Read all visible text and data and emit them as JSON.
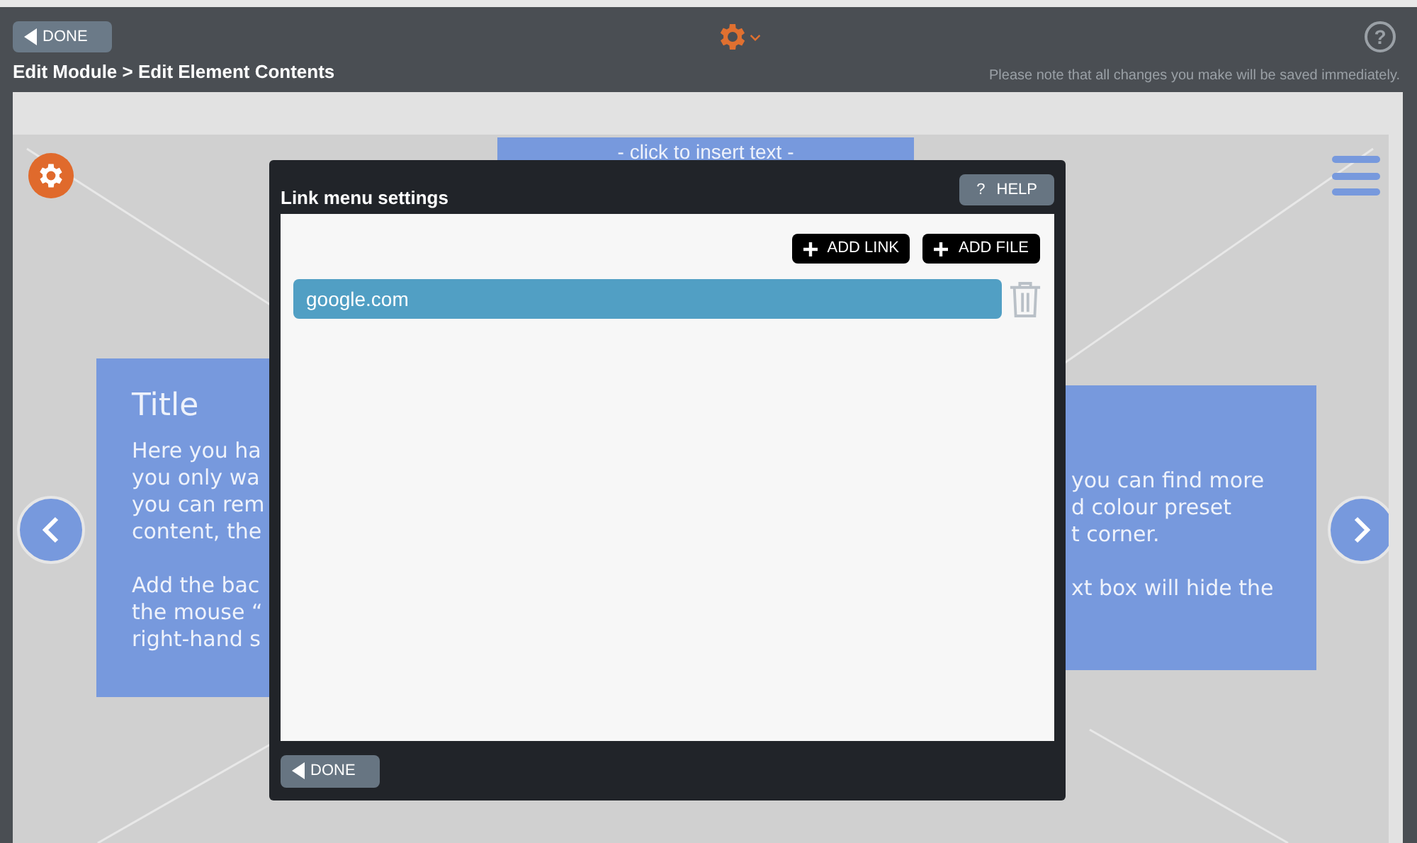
{
  "toolbar": {
    "done_button": "DONE",
    "help_icon": "?",
    "breadcrumb": "Edit Module > Edit Element Contents",
    "notice": "Please note that all changes you make will be saved immediately."
  },
  "canvas": {
    "top_text": "- click to insert text -",
    "left_block": {
      "title": "Title",
      "paragraphs": [
        [
          "Here you ha",
          "you only wa",
          "you can rem",
          "content, the"
        ],
        [
          "Add the bac",
          "the mouse “",
          "right-hand s"
        ]
      ]
    },
    "right_block": {
      "paragraphs": [
        [
          "you can find more",
          "d colour preset",
          "t corner."
        ],
        [
          "xt box will hide the"
        ]
      ]
    }
  },
  "modal": {
    "title": "Link menu settings",
    "help_button": {
      "mark": "?",
      "label": "HELP"
    },
    "buttons": [
      {
        "label": "ADD LINK"
      },
      {
        "label": "ADD FILE"
      }
    ],
    "links": [
      {
        "label": "google.com"
      }
    ],
    "done_button": "DONE"
  }
}
